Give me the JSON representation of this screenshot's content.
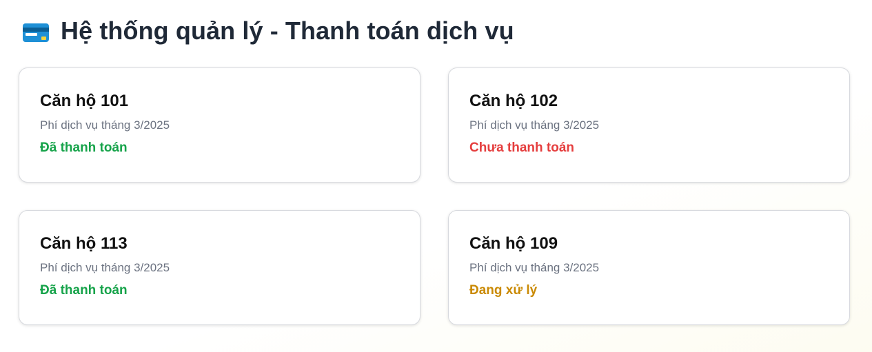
{
  "header": {
    "icon": "credit-card-icon",
    "title": "Hệ thống quản lý - Thanh toán dịch vụ"
  },
  "colors": {
    "paid": "#16a34a",
    "unpaid": "#e53e3e",
    "processing": "#ca8a04"
  },
  "cards": [
    {
      "title": "Căn hộ 101",
      "subtitle": "Phí dịch vụ tháng 3/2025",
      "status": "Đã thanh toán",
      "status_type": "paid"
    },
    {
      "title": "Căn hộ 102",
      "subtitle": "Phí dịch vụ tháng 3/2025",
      "status": "Chưa thanh toán",
      "status_type": "unpaid"
    },
    {
      "title": "Căn hộ 113",
      "subtitle": "Phí dịch vụ tháng 3/2025",
      "status": "Đã thanh toán",
      "status_type": "paid"
    },
    {
      "title": "Căn hộ 109",
      "subtitle": "Phí dịch vụ tháng 3/2025",
      "status": "Đang xử lý",
      "status_type": "processing"
    }
  ]
}
